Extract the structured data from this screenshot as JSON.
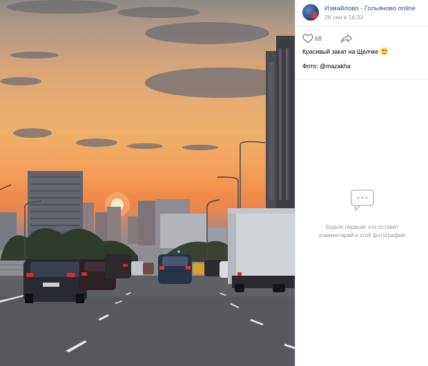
{
  "post": {
    "group_name": "Измайлово - Гольяново online",
    "date": "28 сен в 16:33",
    "likes": "68",
    "caption": "Красивый закат на Щелчке",
    "credit": "Фото: @mazakha"
  },
  "comments": {
    "empty_line1": "Будьте первым, кто оставит",
    "empty_line2": "комментарий к этой фотографии"
  },
  "icons": {
    "avatar": "group-avatar",
    "like": "heart-icon",
    "share": "share-arrow-icon",
    "comments": "chat-bubbles-icon",
    "emoji": "smile-emoji"
  },
  "colors": {
    "link": "#2a5885",
    "muted": "#939699",
    "divider": "#e7e8ec"
  }
}
